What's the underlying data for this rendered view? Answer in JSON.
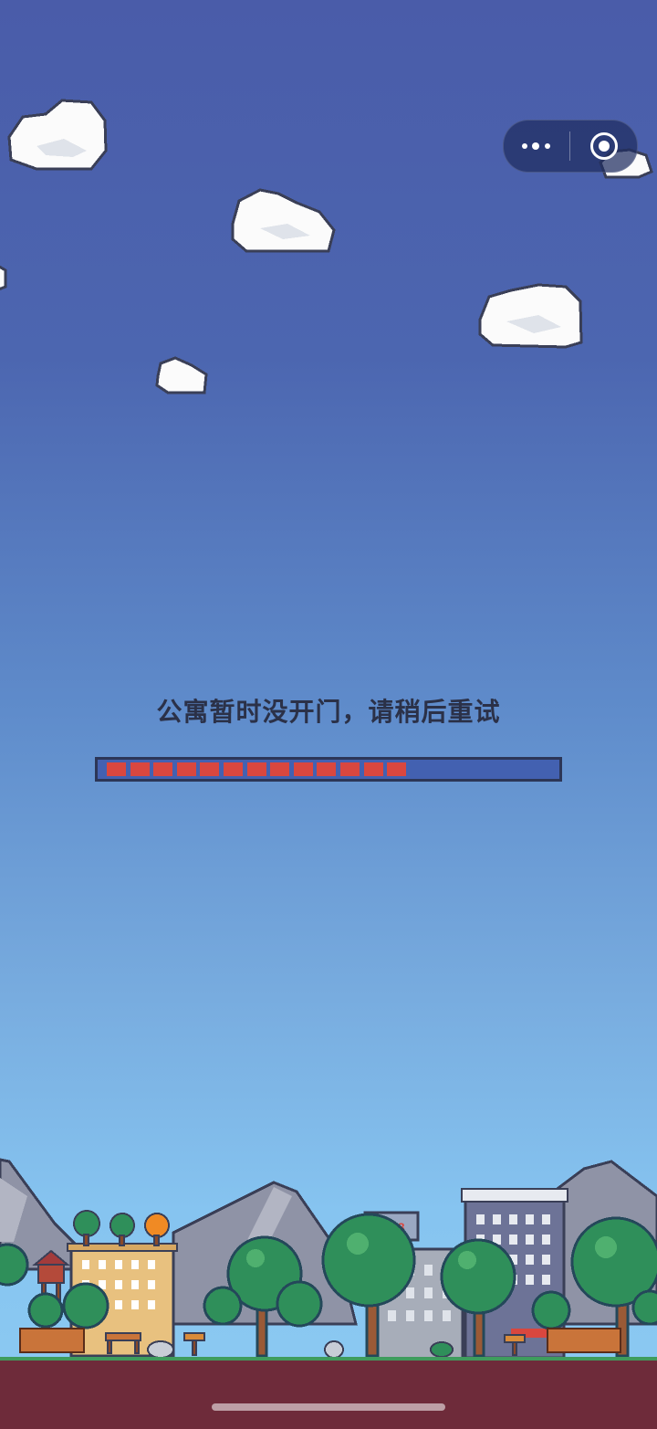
{
  "capsule": {
    "more_icon": "more-dots-icon",
    "close_icon": "target-circle-icon"
  },
  "loading": {
    "message": "公寓暂时没开门，请稍后重试",
    "progress_segments_filled": 13,
    "progress_segments_total": 19,
    "progress_fraction": 0.68
  },
  "colors": {
    "sky_top": "#4a5ca9",
    "sky_bottom": "#8ccaf2",
    "progress_fill": "#d9473f",
    "progress_track": "#4361b1",
    "progress_border": "#2c3657",
    "ground": "#6e2b3a",
    "grass": "#3f9c5d"
  }
}
